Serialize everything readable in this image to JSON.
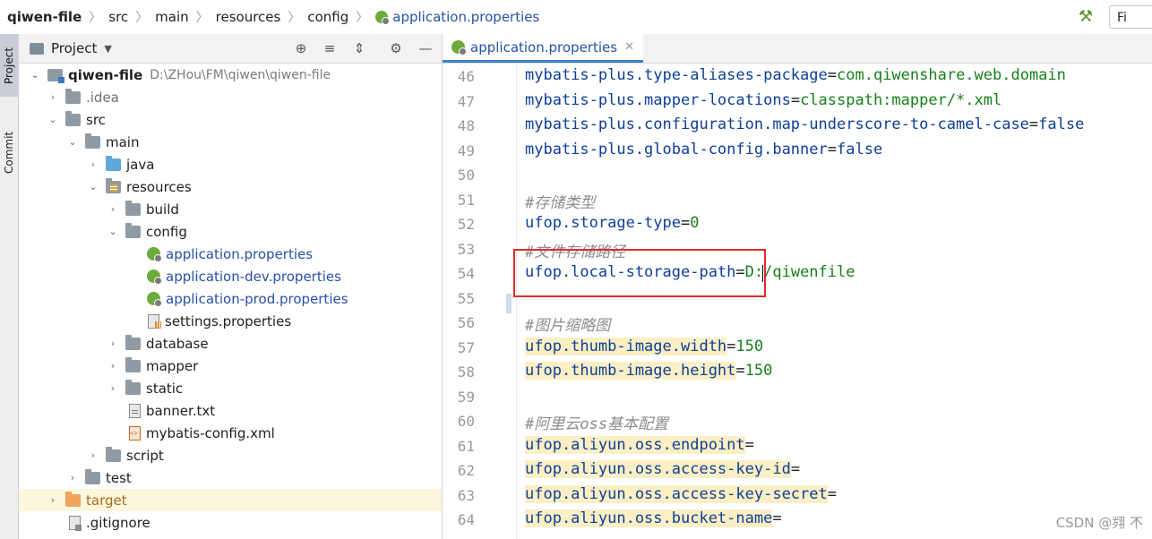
{
  "breadcrumb": {
    "project": "qiwen-file",
    "items": [
      "src",
      "main",
      "resources",
      "config"
    ],
    "file": "application.properties"
  },
  "toolbar": {
    "find_label": "Fi"
  },
  "side_tabs": {
    "project": "Project",
    "commit": "Commit"
  },
  "project_panel": {
    "title": "Project",
    "tree": [
      {
        "label": "qiwen-file",
        "path": "D:\\ZHou\\FM\\qiwen\\qiwen-file",
        "icon": "module",
        "toggle": "open"
      },
      {
        "label": ".idea",
        "icon": "folder",
        "toggle": "closed"
      },
      {
        "label": "src",
        "icon": "folder",
        "toggle": "open"
      },
      {
        "label": "main",
        "icon": "folder",
        "toggle": "open"
      },
      {
        "label": "java",
        "icon": "folder-blue",
        "toggle": "closed"
      },
      {
        "label": "resources",
        "icon": "folder-resources",
        "toggle": "open"
      },
      {
        "label": "build",
        "icon": "folder",
        "toggle": "closed"
      },
      {
        "label": "config",
        "icon": "folder",
        "toggle": "open"
      },
      {
        "label": "application.properties",
        "icon": "spring-leaf",
        "toggle": ""
      },
      {
        "label": "application-dev.properties",
        "icon": "spring-leaf",
        "toggle": ""
      },
      {
        "label": "application-prod.properties",
        "icon": "spring-leaf",
        "toggle": ""
      },
      {
        "label": "settings.properties",
        "icon": "settings-file",
        "toggle": ""
      },
      {
        "label": "database",
        "icon": "folder",
        "toggle": "closed"
      },
      {
        "label": "mapper",
        "icon": "folder",
        "toggle": "closed"
      },
      {
        "label": "static",
        "icon": "folder",
        "toggle": "closed"
      },
      {
        "label": "banner.txt",
        "icon": "text-file",
        "toggle": ""
      },
      {
        "label": "mybatis-config.xml",
        "icon": "xml-file",
        "toggle": ""
      },
      {
        "label": "script",
        "icon": "folder",
        "toggle": "closed"
      },
      {
        "label": "test",
        "icon": "folder",
        "toggle": "closed"
      },
      {
        "label": "target",
        "icon": "folder-excluded",
        "toggle": "closed"
      },
      {
        "label": ".gitignore",
        "icon": "gitignore-file",
        "toggle": ""
      }
    ]
  },
  "editor": {
    "tab_label": "application.properties",
    "lines": [
      {
        "n": "46",
        "key": "mybatis-plus.type-aliases-package",
        "eq": "=",
        "val": "com.qiwenshare.web.domain"
      },
      {
        "n": "47",
        "key": "mybatis-plus.mapper-locations",
        "eq": "=",
        "val": "classpath:mapper/*.xml"
      },
      {
        "n": "48",
        "key": "mybatis-plus.configuration.map-underscore-to-camel-case",
        "eq": "=",
        "val": "false"
      },
      {
        "n": "49",
        "key": "mybatis-plus.global-config.banner",
        "eq": "=",
        "val": "false"
      },
      {
        "n": "50",
        "text": ""
      },
      {
        "n": "51",
        "comment": "#存储类型"
      },
      {
        "n": "52",
        "key": "ufop.storage-type",
        "eq": "=",
        "val": "0"
      },
      {
        "n": "53",
        "comment": "#文件存储路径"
      },
      {
        "n": "54",
        "key": "ufop.local-storage-path",
        "eq": "=",
        "val": "D:/qiwenfile"
      },
      {
        "n": "55",
        "text": ""
      },
      {
        "n": "56",
        "comment": "#图片缩略图"
      },
      {
        "n": "57",
        "key": "ufop.thumb-image.width",
        "eq": "=",
        "val": "150"
      },
      {
        "n": "58",
        "key": "ufop.thumb-image.height",
        "eq": "=",
        "val": "150"
      },
      {
        "n": "59",
        "text": ""
      },
      {
        "n": "60",
        "comment": "#阿里云oss基本配置"
      },
      {
        "n": "61",
        "key": "ufop.aliyun.oss.endpoint",
        "eq": "=",
        "val": ""
      },
      {
        "n": "62",
        "key": "ufop.aliyun.oss.access-key-id",
        "eq": "=",
        "val": ""
      },
      {
        "n": "63",
        "key": "ufop.aliyun.oss.access-key-secret",
        "eq": "=",
        "val": ""
      },
      {
        "n": "64",
        "key": "ufop.aliyun.oss.bucket-name",
        "eq": "=",
        "val": ""
      }
    ]
  },
  "watermark": "CSDN @翙 𣎴",
  "colors": {
    "key": "#0e3e98",
    "value": "#17801a",
    "comment": "#8c8c8c",
    "annotation_box": "#e02b2b",
    "link_blue": "#2850a6"
  }
}
